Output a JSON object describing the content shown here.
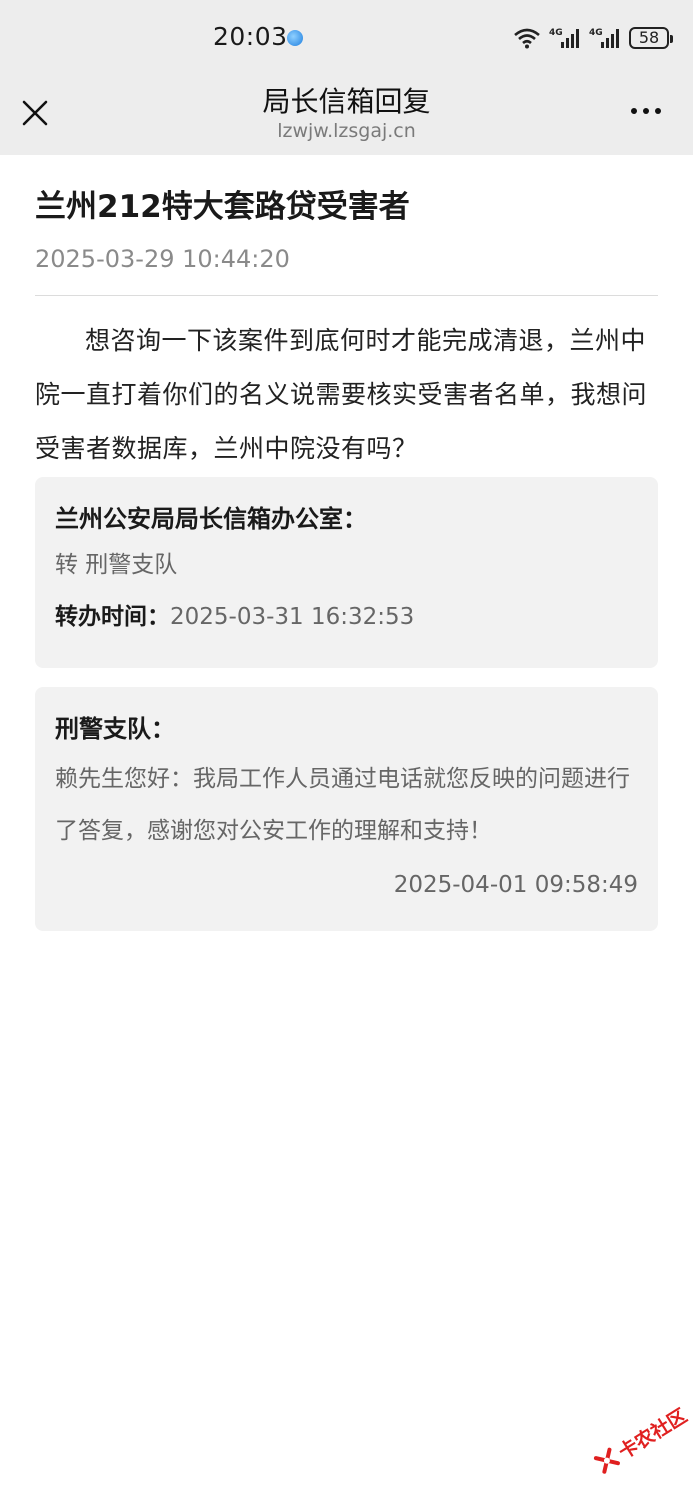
{
  "status_bar": {
    "time": "20:03",
    "network_1": "4G",
    "network_2": "4G",
    "battery": "58"
  },
  "nav": {
    "title": "局长信箱回复",
    "subtitle": "lzwjw.lzsgaj.cn",
    "close_icon": "close-icon",
    "more_icon": "more-icon"
  },
  "article": {
    "title": "兰州212特大套路贷受害者",
    "date": "2025-03-29 10:44:20",
    "question": "想咨询一下该案件到底何时才能完成清退，兰州中院一直打着你们的名义说需要核实受害者名单，我想问受害者数据库，兰州中院没有吗？"
  },
  "forward_card": {
    "heading": "兰州公安局局长信箱办公室：",
    "forward_text": "转 刑警支队",
    "time_label": "转办时间：",
    "time_value": "2025-03-31 16:32:53"
  },
  "reply_card": {
    "heading": "刑警支队：",
    "text": "赖先生您好：我局工作人员通过电话就您反映的问题进行了答复，感谢您对公安工作的理解和支持！",
    "date": "2025-04-01 09:58:49"
  },
  "watermark": {
    "text": "卡农社区"
  },
  "colors": {
    "topbar_bg": "#ededed",
    "card_bg": "#f2f2f2",
    "watermark_red": "#e02020"
  }
}
